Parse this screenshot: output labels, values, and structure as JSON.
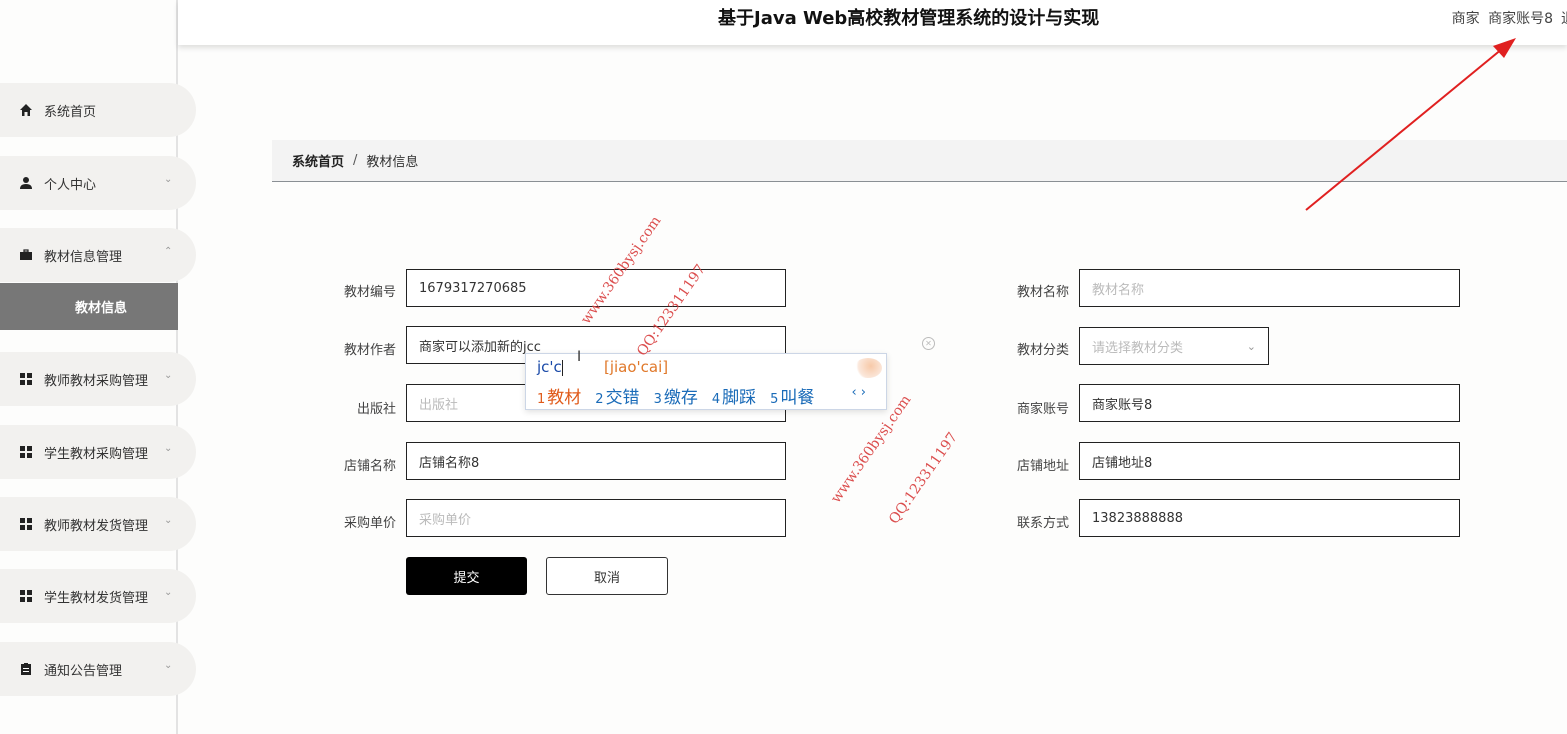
{
  "header": {
    "title": "基于Java Web高校教材管理系统的设计与实现",
    "role": "商家",
    "account": "商家账号8",
    "logout_fragment": "退"
  },
  "sidebar": {
    "items": [
      {
        "label": "系统首页",
        "icon": "home-icon"
      },
      {
        "label": "个人中心",
        "icon": "user-icon"
      },
      {
        "label": "教材信息管理",
        "icon": "briefcase-icon"
      },
      {
        "label": "教师教材采购管理",
        "icon": "grid-icon"
      },
      {
        "label": "学生教材采购管理",
        "icon": "grid-icon"
      },
      {
        "label": "教师教材发货管理",
        "icon": "grid-icon"
      },
      {
        "label": "学生教材发货管理",
        "icon": "grid-icon"
      },
      {
        "label": "通知公告管理",
        "icon": "clipboard-icon"
      }
    ],
    "active_submenu": "教材信息"
  },
  "breadcrumb": {
    "home": "系统首页",
    "separator": "/",
    "current": "教材信息"
  },
  "form": {
    "code_label": "教材编号",
    "code_value": "1679317270685",
    "name_label": "教材名称",
    "name_placeholder": "教材名称",
    "author_label": "教材作者",
    "author_value": "商家可以添加新的jcc",
    "category_label": "教材分类",
    "category_placeholder": "请选择教材分类",
    "publisher_label": "出版社",
    "publisher_placeholder": "出版社",
    "merchant_account_label": "商家账号",
    "merchant_account_value": "商家账号8",
    "shop_name_label": "店铺名称",
    "shop_name_value": "店铺名称8",
    "shop_address_label": "店铺地址",
    "shop_address_value": "店铺地址8",
    "price_label": "采购单价",
    "price_placeholder": "采购单价",
    "contact_label": "联系方式",
    "contact_value": "13823888888",
    "submit_label": "提交",
    "cancel_label": "取消"
  },
  "ime": {
    "composition": "jc'c",
    "pinyin": "[jiao'cai]",
    "candidates": [
      {
        "num": "1",
        "text": "教材"
      },
      {
        "num": "2",
        "text": "交错"
      },
      {
        "num": "3",
        "text": "缴存"
      },
      {
        "num": "4",
        "text": "脚踩"
      },
      {
        "num": "5",
        "text": "叫餐"
      }
    ],
    "nav": "‹ ›"
  },
  "watermark": {
    "site": "www.360bysj.com",
    "qq": "QQ:123311197"
  },
  "colors": {
    "accent_black": "#000000",
    "submenu_bg": "#777777",
    "annotation_red": "#e02020",
    "ime_orange": "#e05a1a",
    "ime_blue": "#1a6bb8"
  }
}
